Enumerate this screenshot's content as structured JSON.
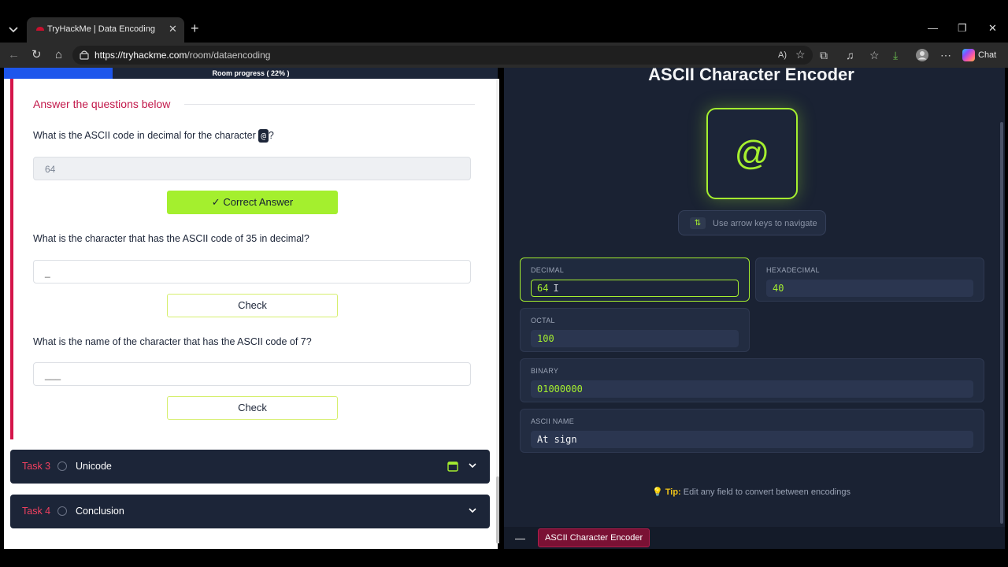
{
  "browser": {
    "tab_title": "TryHackMe | Data Encoding",
    "url_host": "https://tryhackme.com",
    "url_path": "/room/dataencoding",
    "chat_label": "Chat"
  },
  "room": {
    "progress_label": "Room progress ( 22% )",
    "progress_fraction": 0.22
  },
  "questions": {
    "heading": "Answer the questions below",
    "q1_prefix": "What is the ASCII code in decimal for the character ",
    "q1_code": "@",
    "q1_suffix": "?",
    "q1_answer": "64",
    "q1_button": "Correct Answer",
    "q2_text": "What is the character that has the ASCII code of 35 in decimal?",
    "q2_placeholder": "_",
    "q2_button": "Check",
    "q3_text": "What is the name of the character that has the ASCII code of 7?",
    "q3_placeholder": "___",
    "q3_button": "Check"
  },
  "tasks": [
    {
      "num": "Task 3",
      "name": "Unicode"
    },
    {
      "num": "Task 4",
      "name": "Conclusion"
    }
  ],
  "encoder": {
    "title": "ASCII Character Encoder",
    "character": "@",
    "hint": "Use arrow keys to navigate",
    "hint_icon": "⇅",
    "decimal_label": "DECIMAL",
    "decimal_value": "64",
    "hex_label": "HEXADECIMAL",
    "hex_value": "40",
    "octal_label": "OCTAL",
    "octal_value": "100",
    "binary_label": "BINARY",
    "binary_value": "01000000",
    "name_label": "ASCII NAME",
    "name_value": "At sign",
    "tip_label": "Tip:",
    "tip_text": "Edit any field to convert between encodings",
    "tab_label": "ASCII Character Encoder"
  },
  "colors": {
    "accent_green": "#a5ef2f",
    "task_red": "#d4154a",
    "navy": "#1c2538",
    "progress_blue": "#1d56ec"
  }
}
